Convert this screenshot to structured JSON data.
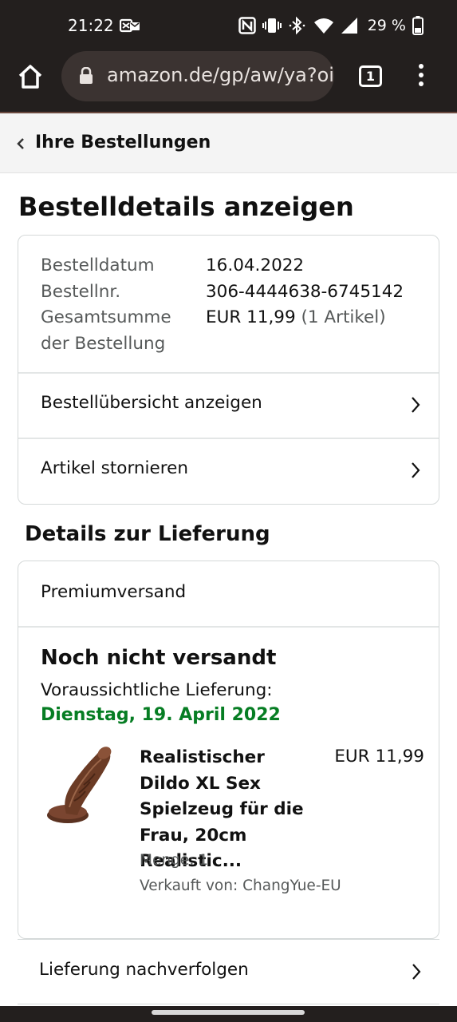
{
  "status_bar": {
    "time": "21:22",
    "battery": "29 %",
    "icons": [
      "notification-icon",
      "nfc-icon",
      "vibrate-icon",
      "bluetooth-icon",
      "wifi-icon",
      "signal-icon",
      "battery-icon"
    ]
  },
  "browser": {
    "url": "amazon.de/gp/aw/ya?oi",
    "tab_count": "1",
    "icons": [
      "home-icon",
      "lock-icon",
      "tabs-icon",
      "more-menu-icon"
    ]
  },
  "nav": {
    "back_label": "Ihre Bestellungen"
  },
  "page": {
    "title": "Bestelldetails anzeigen"
  },
  "order": {
    "date_label": "Bestelldatum",
    "date_value": "16.04.2022",
    "number_label": "Bestellnr.",
    "number_value": "306-4444638-6745142",
    "total_label_line1": "Gesamtsumme",
    "total_label_line2": "der Bestellung",
    "total_value": "EUR 11,99",
    "total_items": "(1 Artikel)",
    "links": [
      {
        "label": "Bestellübersicht anzeigen"
      },
      {
        "label": "Artikel stornieren"
      }
    ]
  },
  "delivery": {
    "section_title": "Details zur Lieferung",
    "shipping_method": "Premiumversand",
    "status": "Noch nicht versandt",
    "eta_label": "Voraussichtliche Lieferung:",
    "eta_date": "Dienstag, 19. April 2022",
    "item": {
      "name": "Realistischer Dildo XL Sex Spielzeug für die Frau, 20cm Realistic...",
      "price": "EUR 11,99",
      "quantity": "Menge: 1",
      "seller": "Verkauft von: ChangYue-EU"
    },
    "track_label": "Lieferung nachverfolgen"
  },
  "colors": {
    "system_bar": "#231f1e",
    "url_bar": "#3b3331",
    "eta_green": "#067d23",
    "card_border": "#d5d9d9"
  }
}
